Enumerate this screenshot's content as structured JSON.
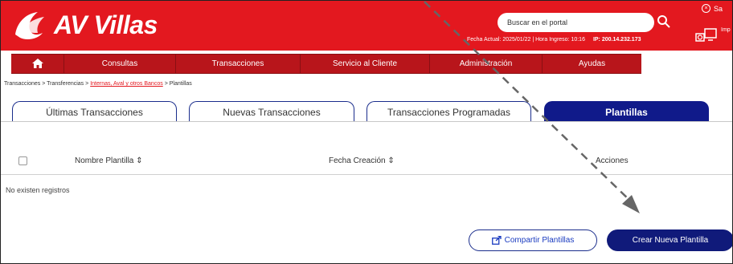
{
  "brand": {
    "name": "AV Villas",
    "color": "#e3181f"
  },
  "header": {
    "search_placeholder": "Buscar en el portal",
    "fecha_label": "Fecha Actual: 2025/01/22 | Hora Ingreso: 10:16",
    "ip_label": "IP: 200.14.232.173",
    "close_session": "Sa",
    "print_label": "Imp"
  },
  "nav": {
    "items": [
      {
        "label": "Consultas"
      },
      {
        "label": "Transacciones"
      },
      {
        "label": "Servicio al Cliente"
      },
      {
        "label": "Administración"
      },
      {
        "label": "Ayudas"
      }
    ]
  },
  "breadcrumb": {
    "part1": "Transacciones",
    "sep": ">",
    "part2": "Transferencias",
    "link": "Internas, Aval y otros Bancos",
    "part3": "Plantillas"
  },
  "tabs": [
    {
      "label": "Últimas Transacciones"
    },
    {
      "label": "Nuevas Transacciones"
    },
    {
      "label": "Transacciones Programadas"
    },
    {
      "label": "Plantillas"
    }
  ],
  "table": {
    "col_name": "Nombre Plantilla ⇕",
    "col_date": "Fecha Creación ⇕",
    "col_actions": "Acciones",
    "empty_text": "No existen registros"
  },
  "buttons": {
    "share": "Compartir Plantillas",
    "create": "Crear Nueva Plantilla"
  }
}
